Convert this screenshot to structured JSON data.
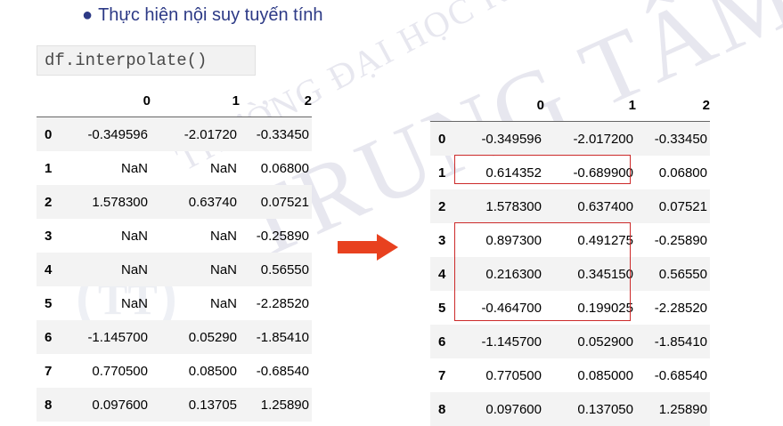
{
  "bullet": {
    "text": "Thực hiện nội suy tuyến tính",
    "marker": "●"
  },
  "code": {
    "text": "df.interpolate()"
  },
  "watermark": {
    "arc_text": "TRƯỜNG ĐẠI HỌC KHOA HỌC TỰ NHIÊN",
    "main_text": "TRUNG TÂM TIN HỌC",
    "logo_text": "TT"
  },
  "before_table": {
    "columns": [
      "0",
      "1",
      "2"
    ],
    "rows": [
      {
        "index": "0",
        "c0": "-0.349596",
        "c1": "-2.01720",
        "c2": "-0.33450"
      },
      {
        "index": "1",
        "c0": "NaN",
        "c1": "NaN",
        "c2": "0.06800"
      },
      {
        "index": "2",
        "c0": "1.578300",
        "c1": "0.63740",
        "c2": "0.07521"
      },
      {
        "index": "3",
        "c0": "NaN",
        "c1": "NaN",
        "c2": "-0.25890"
      },
      {
        "index": "4",
        "c0": "NaN",
        "c1": "NaN",
        "c2": "0.56550"
      },
      {
        "index": "5",
        "c0": "NaN",
        "c1": "NaN",
        "c2": "-2.28520"
      },
      {
        "index": "6",
        "c0": "-1.145700",
        "c1": "0.05290",
        "c2": "-1.85410"
      },
      {
        "index": "7",
        "c0": "0.770500",
        "c1": "0.08500",
        "c2": "-0.68540"
      },
      {
        "index": "8",
        "c0": "0.097600",
        "c1": "0.13705",
        "c2": "1.25890"
      }
    ]
  },
  "after_table": {
    "columns": [
      "0",
      "1",
      "2"
    ],
    "rows": [
      {
        "index": "0",
        "c0": "-0.349596",
        "c1": "-2.017200",
        "c2": "-0.33450"
      },
      {
        "index": "1",
        "c0": "0.614352",
        "c1": "-0.689900",
        "c2": "0.06800"
      },
      {
        "index": "2",
        "c0": "1.578300",
        "c1": "0.637400",
        "c2": "0.07521"
      },
      {
        "index": "3",
        "c0": "0.897300",
        "c1": "0.491275",
        "c2": "-0.25890"
      },
      {
        "index": "4",
        "c0": "0.216300",
        "c1": "0.345150",
        "c2": "0.56550"
      },
      {
        "index": "5",
        "c0": "-0.464700",
        "c1": "0.199025",
        "c2": "-2.28520"
      },
      {
        "index": "6",
        "c0": "-1.145700",
        "c1": "0.052900",
        "c2": "-1.85410"
      },
      {
        "index": "7",
        "c0": "0.770500",
        "c1": "0.085000",
        "c2": "-0.68540"
      },
      {
        "index": "8",
        "c0": "0.097600",
        "c1": "0.137050",
        "c2": "1.25890"
      }
    ]
  },
  "colors": {
    "bullet_text": "#2d3a86",
    "highlight": "#cc2a2a",
    "arrow": "#e8411f",
    "row_stripe": "#f3f3f3"
  },
  "icons": {
    "arrow": "right-arrow-icon"
  }
}
